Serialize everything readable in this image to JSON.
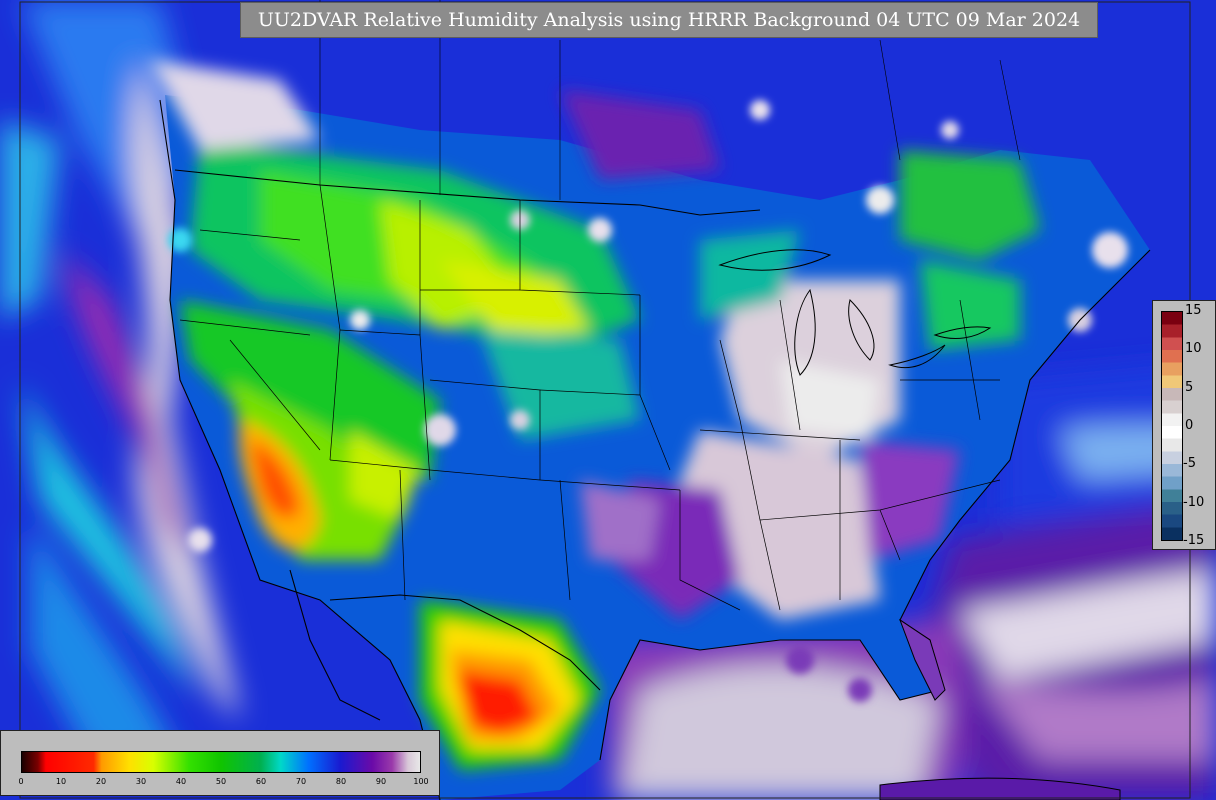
{
  "title": "UU2DVAR Relative Humidity Analysis using HRRR Background 04 UTC 09 Mar 2024",
  "rh_colorbar": {
    "ticks": [
      "0",
      "10",
      "20",
      "30",
      "40",
      "50",
      "60",
      "70",
      "80",
      "90",
      "100"
    ],
    "tick_values": [
      0,
      10,
      20,
      30,
      40,
      50,
      60,
      70,
      80,
      90,
      100
    ],
    "stops": [
      {
        "v": 0,
        "c": "#1a0000"
      },
      {
        "v": 4,
        "c": "#7a0000"
      },
      {
        "v": 6,
        "c": "#ff0000"
      },
      {
        "v": 18,
        "c": "#ff2a00"
      },
      {
        "v": 20,
        "c": "#ff9a00"
      },
      {
        "v": 27,
        "c": "#ffe000"
      },
      {
        "v": 33,
        "c": "#d8ff00"
      },
      {
        "v": 42,
        "c": "#34e000"
      },
      {
        "v": 50,
        "c": "#10c400"
      },
      {
        "v": 60,
        "c": "#00b050"
      },
      {
        "v": 65,
        "c": "#00d8c8"
      },
      {
        "v": 72,
        "c": "#0070ff"
      },
      {
        "v": 80,
        "c": "#1a1ad0"
      },
      {
        "v": 88,
        "c": "#6a0aa8"
      },
      {
        "v": 93,
        "c": "#9a3aaa"
      },
      {
        "v": 97,
        "c": "#d8c8d8"
      },
      {
        "v": 100,
        "c": "#e8e8e8"
      }
    ]
  },
  "diff_colorbar": {
    "ticks": [
      "15",
      "10",
      "5",
      "0",
      "-5",
      "-10",
      "-15"
    ],
    "tick_values": [
      15,
      10,
      5,
      0,
      -5,
      -10,
      -15
    ],
    "colors": [
      "#7a0010",
      "#a8202a",
      "#d05050",
      "#e07050",
      "#e8a060",
      "#f0c878",
      "#c8b8b8",
      "#d8d0d0",
      "#f2f2f2",
      "#ffffff",
      "#e8e8e8",
      "#c8d0e0",
      "#9ab8d8",
      "#70a0c8",
      "#408098",
      "#2a6088",
      "#1a4880",
      "#0a3060"
    ]
  },
  "map_colors": {
    "ocean": "#1a2fd8",
    "land_dry": "#ff2000",
    "border": "#000000"
  }
}
